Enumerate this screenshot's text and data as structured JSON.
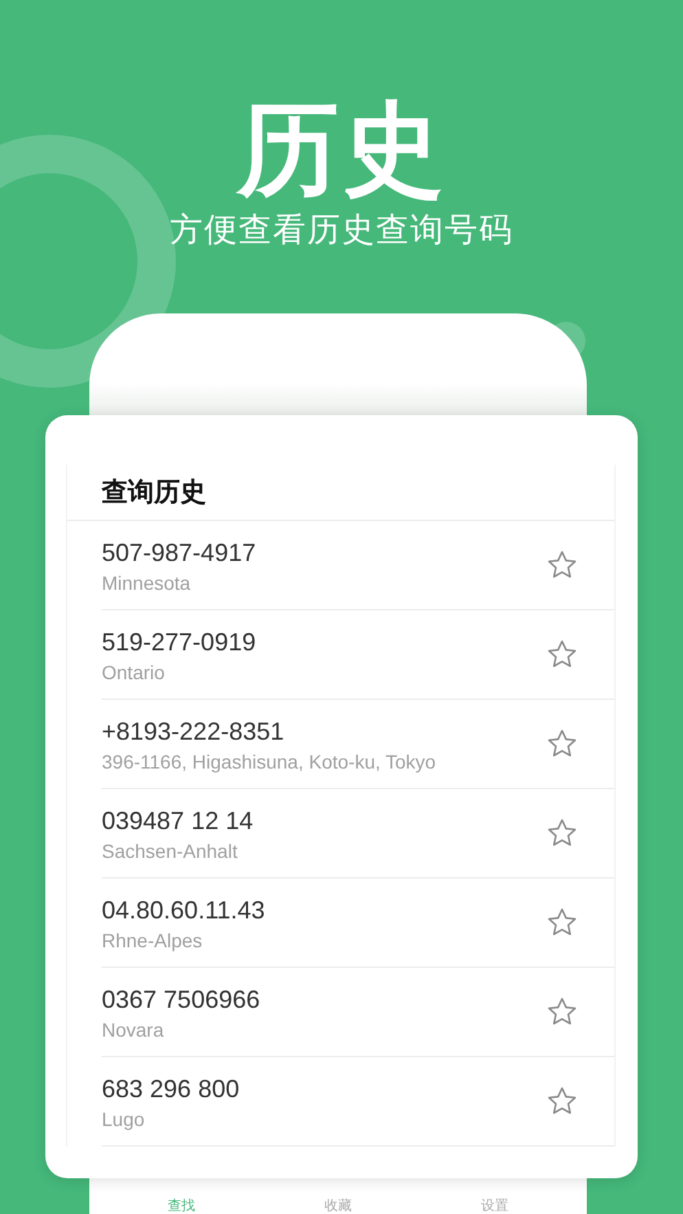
{
  "headline": "历史",
  "subtitle": "方便查看历史查询号码",
  "history": {
    "title": "查询历史",
    "rows": [
      {
        "number": "507-987-4917",
        "location": "Minnesota",
        "favorited": false
      },
      {
        "number": "519-277-0919",
        "location": "Ontario",
        "favorited": false
      },
      {
        "number": "+8193-222-8351",
        "location": "396-1166, Higashisuna, Koto-ku, Tokyo",
        "favorited": false
      },
      {
        "number": "039487 12 14",
        "location": "Sachsen-Anhalt",
        "favorited": false
      },
      {
        "number": "04.80.60.11.43",
        "location": "Rhne-Alpes",
        "favorited": false
      },
      {
        "number": "0367 7506966",
        "location": "Novara",
        "favorited": false
      },
      {
        "number": "683 296 800",
        "location": "Lugo",
        "favorited": false
      }
    ]
  },
  "tab_bar": [
    {
      "label": "查找",
      "selected": true
    },
    {
      "label": "收藏",
      "selected": false
    },
    {
      "label": "设置",
      "selected": false
    }
  ]
}
